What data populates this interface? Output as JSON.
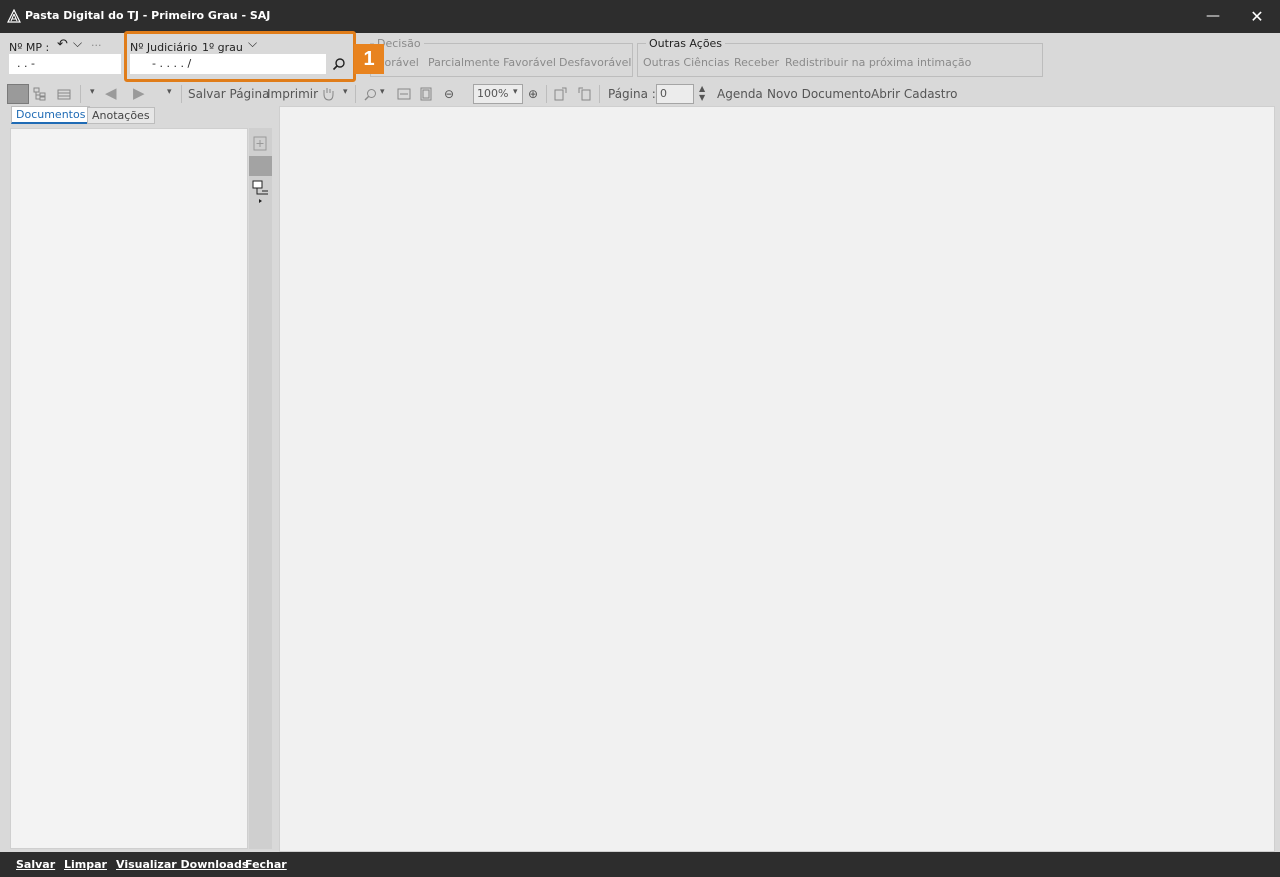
{
  "window": {
    "title": "Pasta Digital do TJ - Primeiro Grau - SAJ",
    "minimize_glyph": "—",
    "close_glyph": "✕"
  },
  "ribbon": {
    "mp_label": "Nº MP :",
    "mp_value": ".    .          -",
    "undo_glyph": "↶",
    "chevron_glyph": "⌵",
    "more_glyph": "···",
    "judiciario_label": "Nº Judiciário",
    "grau_value": "1º grau",
    "judiciario_value": "-  .    .  .  .   /",
    "decisao_title": "Decisão",
    "decisao_items": [
      "vorável",
      "Parcialmente Favorável",
      "Desfavorável"
    ],
    "outras_title": "Outras Ações",
    "outras_items": [
      "Outras Ciências",
      "Receber",
      "Redistribuir na próxima intimação"
    ],
    "annotation_badge": "1"
  },
  "toolbar": {
    "salvar_pagina": "Salvar Página",
    "imprimir": "Imprimir",
    "zoom": "100%",
    "pagina_label": "Página :",
    "pagina_value": "0",
    "agenda": "Agenda",
    "novo_documento": "Novo Documento",
    "abrir_cadastro": "Abrir Cadastro"
  },
  "left_panel": {
    "tabs": [
      "Documentos",
      "Anotações"
    ]
  },
  "statusbar": {
    "salvar": "Salvar",
    "limpar": "Limpar",
    "visualizar_downloads": "Visualizar Downloads",
    "fechar": "Fechar"
  },
  "colors": {
    "titlebar": "#2d2d2d",
    "highlight": "#e07d1a",
    "active_tab": "#1f6bb5"
  }
}
